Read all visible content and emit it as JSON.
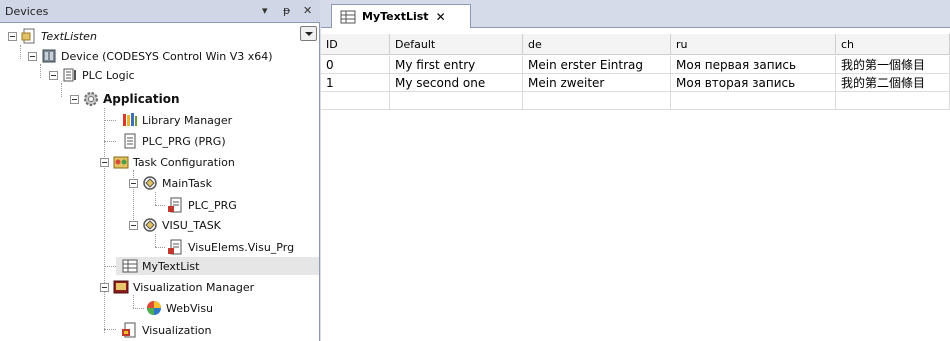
{
  "devices_pane": {
    "title": "Devices",
    "menu_arrow": "▾",
    "pin_glyph": "ᵽ",
    "close_glyph": "✕"
  },
  "tree": [
    {
      "label": "TextListen",
      "icon": "project-icon",
      "style": "italic"
    },
    {
      "label": "Device (CODESYS Control Win V3 x64)",
      "icon": "device-icon",
      "style": "normal"
    },
    {
      "label": "PLC Logic",
      "icon": "plc-logic-icon",
      "style": "normal"
    },
    {
      "label": "Application",
      "icon": "gear-icon",
      "style": "bold"
    },
    {
      "label": "Library Manager",
      "icon": "library-icon",
      "style": "normal"
    },
    {
      "label": "PLC_PRG (PRG)",
      "icon": "pou-icon",
      "style": "normal"
    },
    {
      "label": "Task Configuration",
      "icon": "task-config-icon",
      "style": "normal"
    },
    {
      "label": "MainTask",
      "icon": "task-icon",
      "style": "normal"
    },
    {
      "label": "PLC_PRG",
      "icon": "program-call-icon",
      "style": "normal"
    },
    {
      "label": "VISU_TASK",
      "icon": "task-icon",
      "style": "normal"
    },
    {
      "label": "VisuElems.Visu_Prg",
      "icon": "program-call-icon",
      "style": "normal"
    },
    {
      "label": "MyTextList",
      "icon": "textlist-icon",
      "style": "normal",
      "selected": true
    },
    {
      "label": "Visualization Manager",
      "icon": "visu-manager-icon",
      "style": "normal"
    },
    {
      "label": "WebVisu",
      "icon": "webvisu-icon",
      "style": "normal"
    },
    {
      "label": "Visualization",
      "icon": "visualization-icon",
      "style": "normal"
    }
  ],
  "editor": {
    "tab_label": "MyTextList",
    "tab_close": "✕",
    "columns": [
      "ID",
      "Default",
      "de",
      "ru",
      "ch"
    ],
    "rows": [
      [
        "0",
        "My first entry",
        "Mein erster Eintrag",
        "Моя первая запись",
        "我的第一個條目"
      ],
      [
        "1",
        "My second one",
        "Mein zweiter",
        "Моя вторая запись",
        "我的第二個條目"
      ],
      [
        "",
        "",
        "",
        "",
        ""
      ]
    ]
  }
}
